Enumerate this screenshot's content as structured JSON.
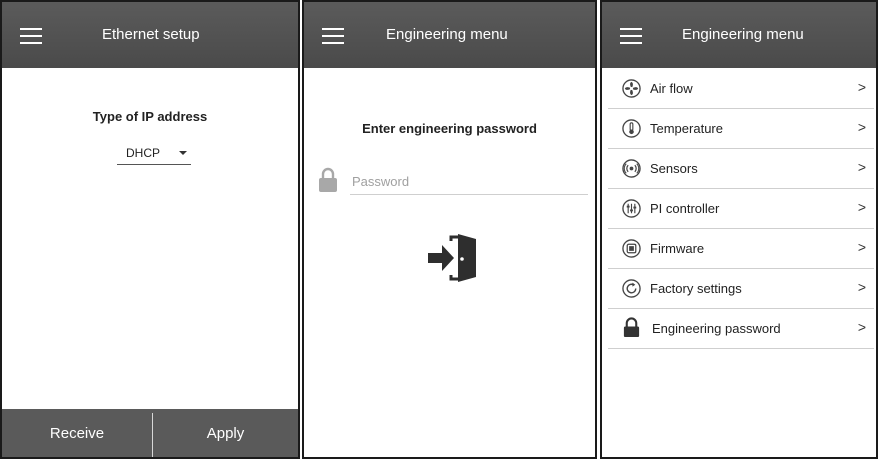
{
  "screen1": {
    "title": "Ethernet setup",
    "ip_label": "Type of IP address",
    "ip_value": "DHCP",
    "receive_label": "Receive",
    "apply_label": "Apply"
  },
  "screen2": {
    "title": "Engineering menu",
    "prompt": "Enter engineering password",
    "password_placeholder": "Password"
  },
  "screen3": {
    "title": "Engineering menu",
    "items": [
      {
        "label": "Air flow",
        "icon": "fan-icon"
      },
      {
        "label": "Temperature",
        "icon": "thermometer-icon"
      },
      {
        "label": "Sensors",
        "icon": "sensor-icon"
      },
      {
        "label": "PI controller",
        "icon": "controller-icon"
      },
      {
        "label": "Firmware",
        "icon": "chip-icon"
      },
      {
        "label": "Factory settings",
        "icon": "reset-icon"
      },
      {
        "label": "Engineering password",
        "icon": "lock-icon"
      }
    ],
    "chevron": ">"
  },
  "colors": {
    "header_bg": "#4f4f4f",
    "footer_bg": "#5a5a5a",
    "frame": "#1a1a1a"
  }
}
